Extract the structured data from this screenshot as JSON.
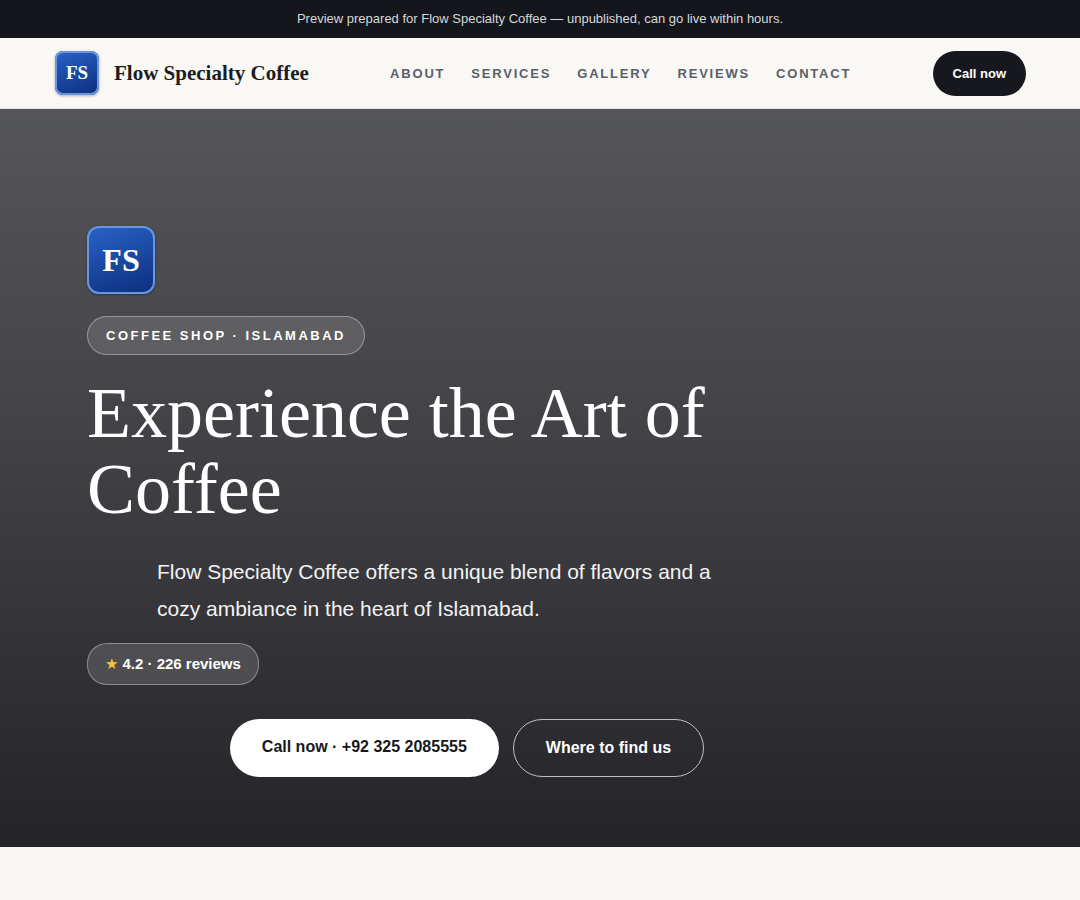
{
  "banner": "Preview prepared for Flow Specialty Coffee — unpublished, can go live within hours.",
  "nav": {
    "logo": "FS",
    "brand": "Flow Specialty Coffee",
    "links": [
      "ABOUT",
      "SERVICES",
      "GALLERY",
      "REVIEWS",
      "CONTACT"
    ],
    "cta": "Call now"
  },
  "hero": {
    "logo": "FS",
    "tag": "COFFEE SHOP · ISLAMABAD",
    "title": "Experience the Art of Coffee",
    "subtitle": "Flow Specialty Coffee offers a unique blend of flavors and a cozy ambiance in the heart of Islamabad.",
    "rating": {
      "star": "★",
      "text": "4.2 · 226 reviews"
    },
    "buttons": [
      "Call now · +92 325 2085555",
      "Where to find us"
    ]
  }
}
